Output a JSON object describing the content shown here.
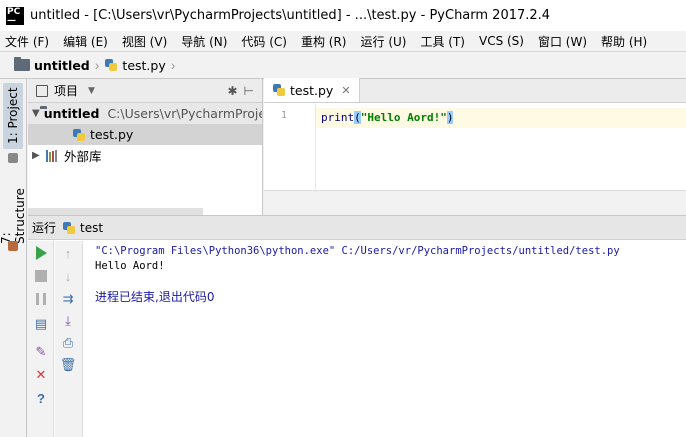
{
  "window": {
    "logo_line1": "PC",
    "logo_line2": "—",
    "title": "untitled - [C:\\Users\\vr\\PycharmProjects\\untitled] - ...\\test.py - PyCharm 2017.2.4"
  },
  "menu": [
    "文件 (F)",
    "编辑 (E)",
    "视图 (V)",
    "导航 (N)",
    "代码 (C)",
    "重构 (R)",
    "运行 (U)",
    "工具 (T)",
    "VCS (S)",
    "窗口 (W)",
    "帮助 (H)"
  ],
  "breadcrumb": {
    "project": "untitled",
    "file": "test.py"
  },
  "left_stripe": {
    "project_tab": "1: Project",
    "structure_tab": "7: Structure"
  },
  "project_panel": {
    "header": "项目",
    "root_name": "untitled",
    "root_path": "C:\\Users\\vr\\PycharmProjects\\untitled",
    "file": "test.py",
    "external_libs": "外部库"
  },
  "editor": {
    "tab_label": "test.py",
    "line_number": "1",
    "code_fn": "print",
    "code_open": "(",
    "code_str": "\"Hello Aord!\"",
    "code_close": ")"
  },
  "run_panel": {
    "label": "运行",
    "config": "test",
    "command": "\"C:\\Program Files\\Python36\\python.exe\" C:/Users/vr/PycharmProjects/untitled/test.py",
    "output": "Hello Aord!",
    "exit_message": "进程已结束,退出代码0"
  },
  "colors": {
    "run_green": "#3aa34a",
    "console_blue": "#1a1aa6",
    "string_green": "#008000",
    "caret_line": "#fffae3"
  }
}
